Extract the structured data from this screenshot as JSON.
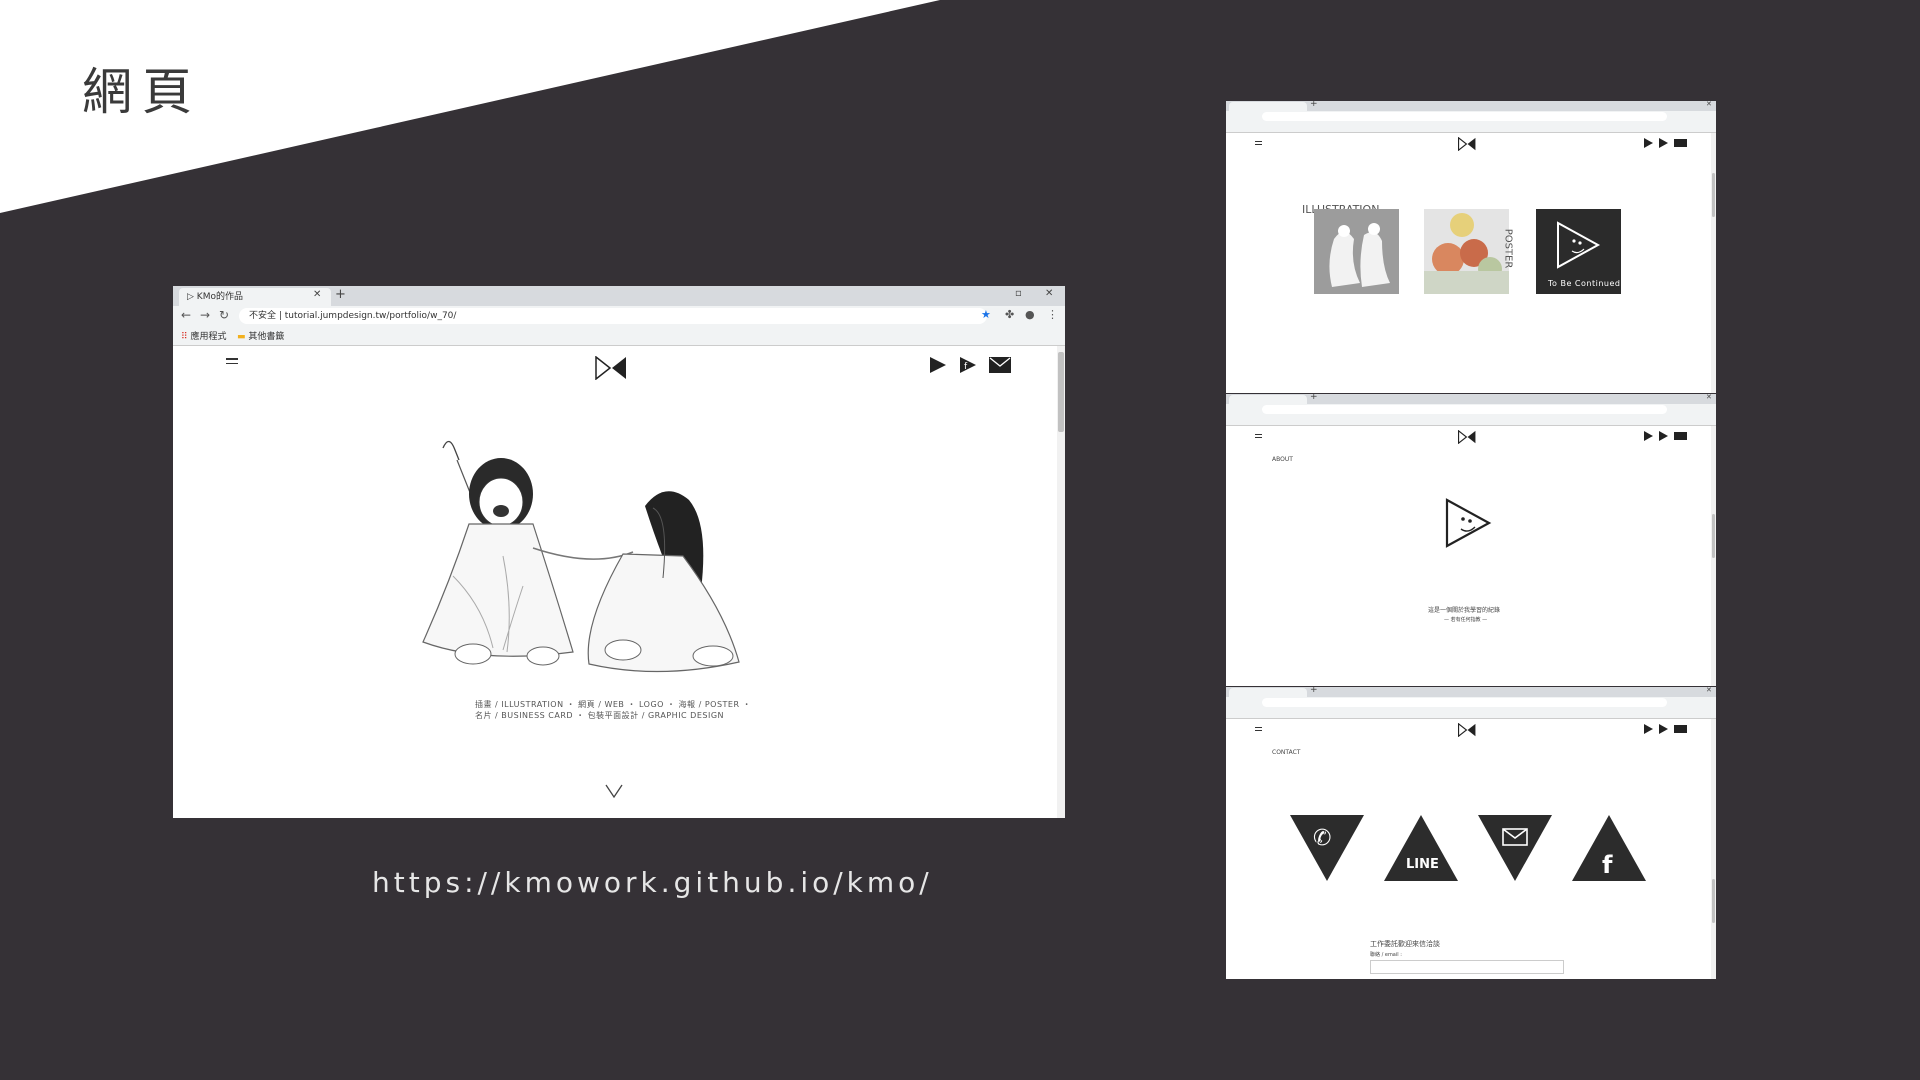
{
  "slide": {
    "title": "網頁",
    "url": "https://kmowork.github.io/kmo/"
  },
  "browser_main": {
    "tab_title": "KMo的作品",
    "address": "不安全 | tutorial.jumpdesign.tw/portfolio/w_70/",
    "bookmarks": [
      "應用程式",
      "其他書籤"
    ],
    "caption_line1": "插畫 / ILLUSTRATION ・ 網頁 / WEB ・ LOGO ・ 海報 / POSTER ・",
    "caption_line2": "名片 / BUSINESS CARD ・ 包裝平面設計 / GRAPHIC DESIGN"
  },
  "browser_small_1": {
    "heading": "ILLUSTRATION",
    "poster_label": "POSTER",
    "tile_caption": "To Be Continued"
  },
  "browser_small_2": {
    "section_label": "ABOUT",
    "text_line1": "這是一個關於我學習的紀錄",
    "text_line2": "— 若有任何指教 —"
  },
  "browser_small_3": {
    "section_label": "CONTACT",
    "line_label": "LINE",
    "form_label": "工作委託歡迎來信洽談",
    "form_sub": "聯絡 / email :"
  },
  "colors": {
    "background": "#353136",
    "slide_white": "#ffffff",
    "icon_dark": "#2c2c2c",
    "chrome_gray": "#d7dade"
  }
}
